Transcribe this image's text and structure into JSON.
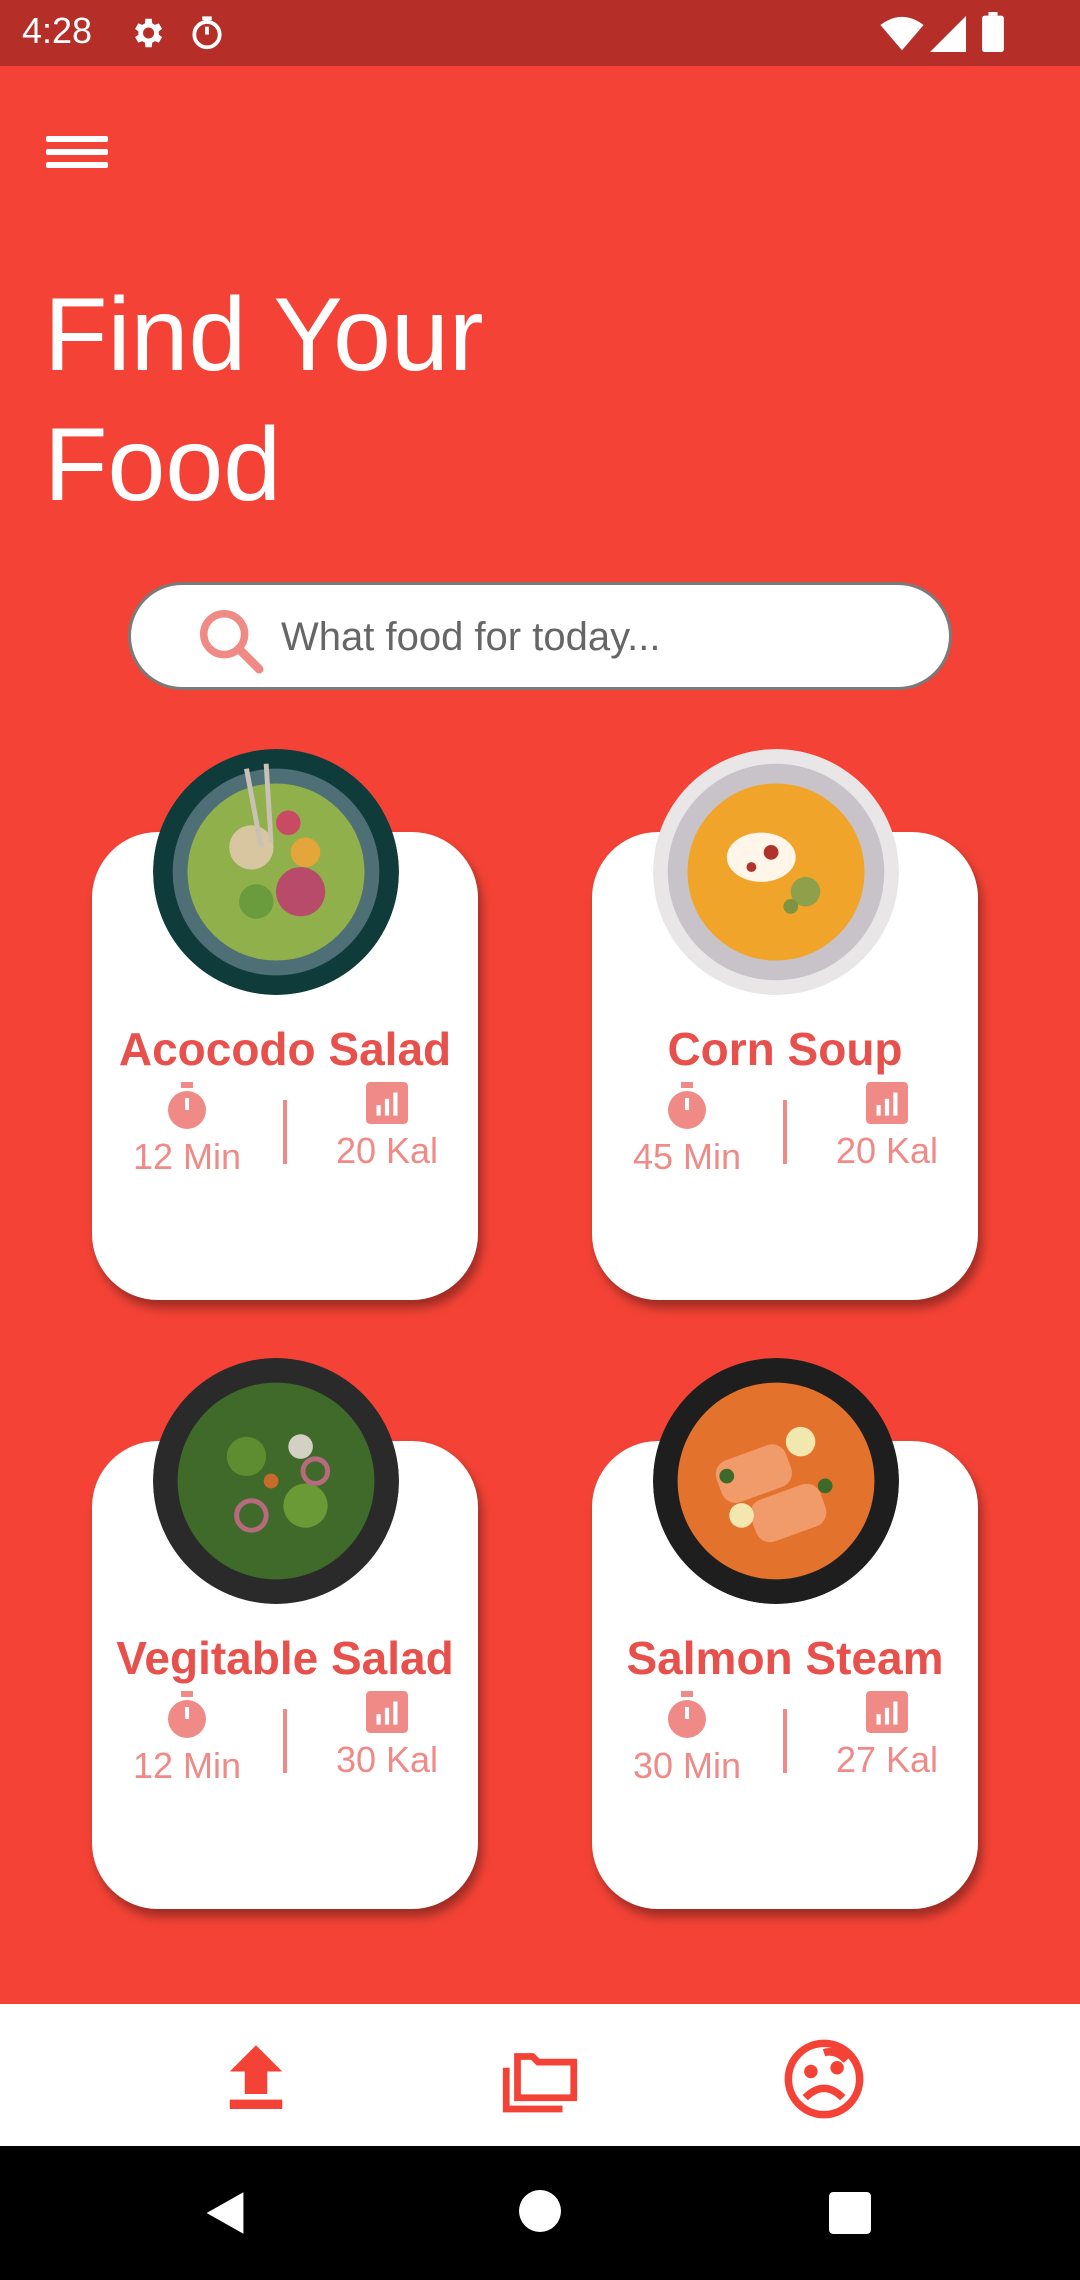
{
  "status_bar": {
    "time": "4:28"
  },
  "header": {
    "title": "Find Your\nFood"
  },
  "search": {
    "placeholder": "What food for today..."
  },
  "foods": [
    {
      "name": "Acocodo Salad",
      "time": "12 Min",
      "calories": "20 Kal"
    },
    {
      "name": "Corn Soup",
      "time": "45 Min",
      "calories": "20 Kal"
    },
    {
      "name": "Vegitable Salad",
      "time": "12 Min",
      "calories": "30 Kal"
    },
    {
      "name": "Salmon Steam",
      "time": "30 Min",
      "calories": "27 Kal"
    }
  ],
  "bottom_nav": {
    "icons": [
      "upload-icon",
      "folder-icon",
      "face-icon"
    ]
  },
  "colors": {
    "background": "#f44336",
    "status_bar": "#b62e28",
    "accent_text": "#e8504c",
    "stat_text": "#f08a86"
  }
}
